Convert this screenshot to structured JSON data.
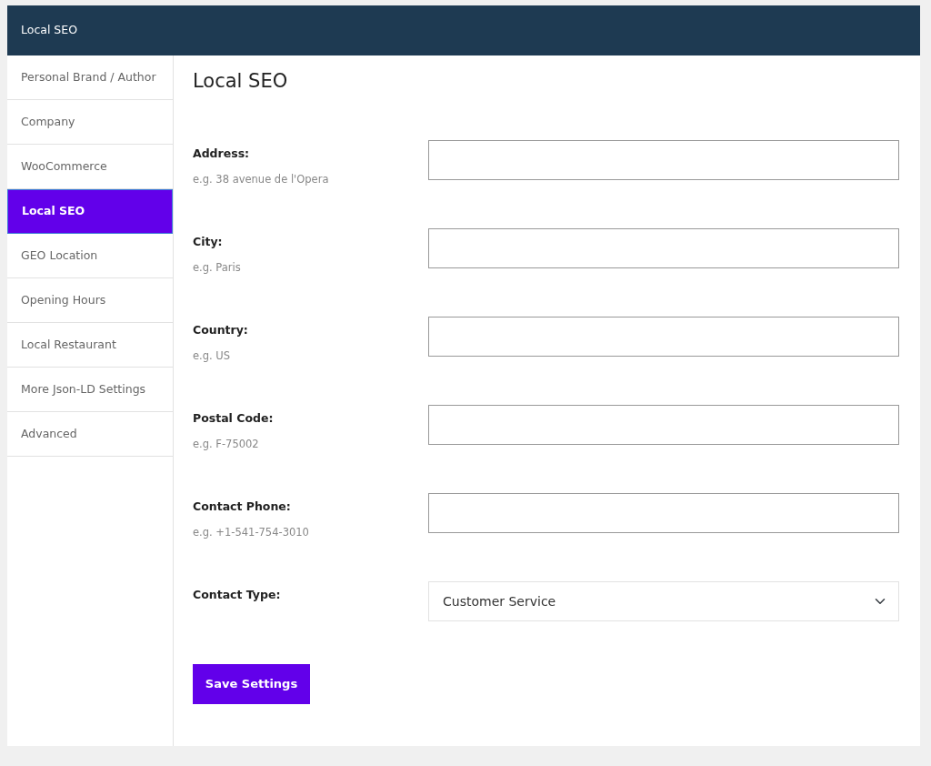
{
  "header": {
    "title": "Local SEO"
  },
  "sidebar": {
    "items": [
      {
        "label": "Personal Brand / Author",
        "selected": false
      },
      {
        "label": "Company",
        "selected": false
      },
      {
        "label": "WooCommerce",
        "selected": false
      },
      {
        "label": "Local SEO",
        "selected": true
      },
      {
        "label": "GEO Location",
        "selected": false
      },
      {
        "label": "Opening Hours",
        "selected": false
      },
      {
        "label": "Local Restaurant",
        "selected": false
      },
      {
        "label": "More Json-LD Settings",
        "selected": false
      },
      {
        "label": "Advanced",
        "selected": false
      }
    ]
  },
  "page_title": "Local SEO",
  "fields": [
    {
      "kind": "text",
      "label": "Address:",
      "hint": "e.g. 38 avenue de l'Opera"
    },
    {
      "kind": "text",
      "label": "City:",
      "hint": "e.g. Paris"
    },
    {
      "kind": "text",
      "label": "Country:",
      "hint": "e.g. US"
    },
    {
      "kind": "text",
      "label": "Postal Code:",
      "hint": "e.g. F-75002"
    },
    {
      "kind": "text",
      "label": "Contact Phone:",
      "hint": "e.g. +1-541-754-3010"
    },
    {
      "kind": "select",
      "label": "Contact Type:",
      "value": "Customer Service"
    }
  ],
  "save_button": "Save Settings"
}
